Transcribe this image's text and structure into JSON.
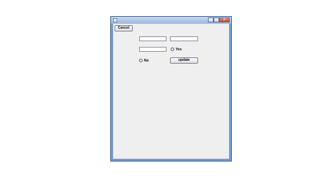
{
  "window": {
    "title": "",
    "controls": {
      "minimize": "",
      "maximize": "",
      "close": "x"
    }
  },
  "form": {
    "cancel_label": "Cancel",
    "field_1": "",
    "field_2": "",
    "field_3": "",
    "radio_yes_label": "Yes",
    "radio_no_label": "No",
    "update_label": "update"
  }
}
